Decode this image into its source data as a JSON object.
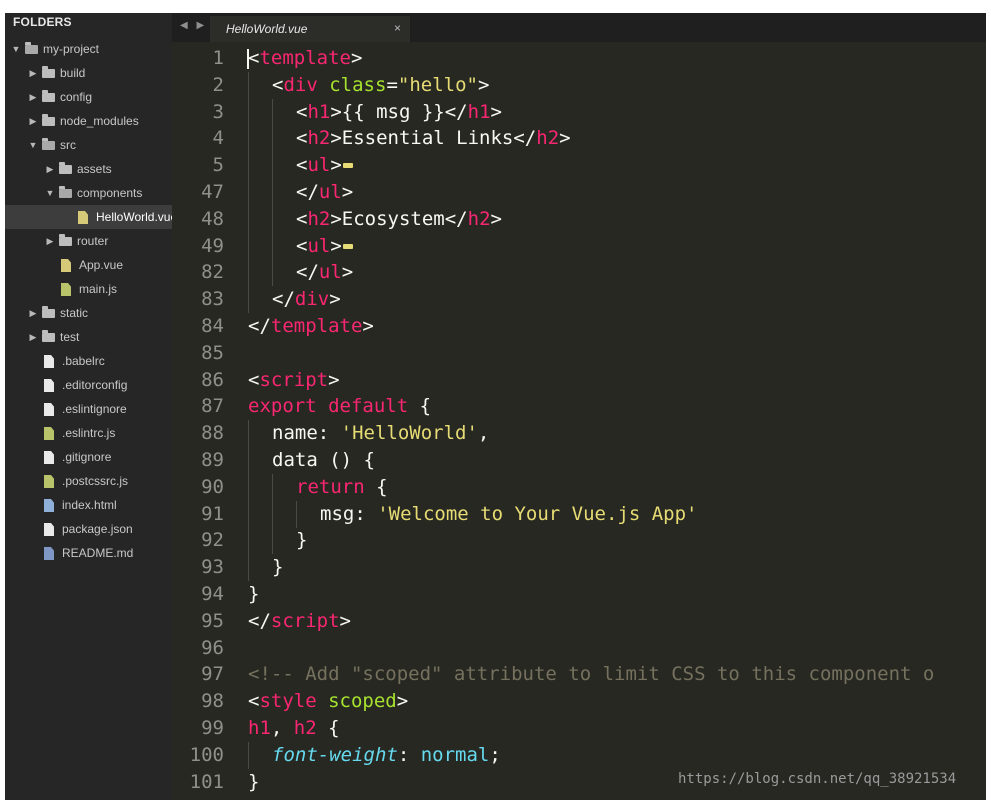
{
  "colors": {
    "tag": "#f92672",
    "attr": "#a6e22e",
    "string": "#e6db74",
    "plain": "#f8f8f2",
    "comment": "#75715e",
    "property": "#66d9ef",
    "fold": "#e6db74"
  },
  "sidebar": {
    "header": "FOLDERS",
    "items": [
      {
        "label": "my-project",
        "kind": "folder",
        "open": true,
        "depth": 0
      },
      {
        "label": "build",
        "kind": "folder",
        "open": false,
        "depth": 1
      },
      {
        "label": "config",
        "kind": "folder",
        "open": false,
        "depth": 1
      },
      {
        "label": "node_modules",
        "kind": "folder",
        "open": false,
        "depth": 1
      },
      {
        "label": "src",
        "kind": "folder",
        "open": true,
        "depth": 1
      },
      {
        "label": "assets",
        "kind": "folder",
        "open": false,
        "depth": 2
      },
      {
        "label": "components",
        "kind": "folder",
        "open": true,
        "depth": 2
      },
      {
        "label": "HelloWorld.vue",
        "kind": "file",
        "type": "vue",
        "depth": 3,
        "selected": true
      },
      {
        "label": "router",
        "kind": "folder",
        "open": false,
        "depth": 2
      },
      {
        "label": "App.vue",
        "kind": "file",
        "type": "vue",
        "depth": 2
      },
      {
        "label": "main.js",
        "kind": "file",
        "type": "js",
        "depth": 2
      },
      {
        "label": "static",
        "kind": "folder",
        "open": false,
        "depth": 1
      },
      {
        "label": "test",
        "kind": "folder",
        "open": false,
        "depth": 1
      },
      {
        "label": ".babelrc",
        "kind": "file",
        "type": "text",
        "depth": 1
      },
      {
        "label": ".editorconfig",
        "kind": "file",
        "type": "text",
        "depth": 1
      },
      {
        "label": ".eslintignore",
        "kind": "file",
        "type": "text",
        "depth": 1
      },
      {
        "label": ".eslintrc.js",
        "kind": "file",
        "type": "js",
        "depth": 1
      },
      {
        "label": ".gitignore",
        "kind": "file",
        "type": "text",
        "depth": 1
      },
      {
        "label": ".postcssrc.js",
        "kind": "file",
        "type": "js",
        "depth": 1
      },
      {
        "label": "index.html",
        "kind": "file",
        "type": "html",
        "depth": 1
      },
      {
        "label": "package.json",
        "kind": "file",
        "type": "text",
        "depth": 1
      },
      {
        "label": "README.md",
        "kind": "file",
        "type": "md",
        "depth": 1
      }
    ]
  },
  "tabbar": {
    "nav_icons": "◀ ▶",
    "active_tab": "HelloWorld.vue",
    "close_glyph": "×"
  },
  "editor": {
    "lines": [
      {
        "n": "1",
        "indent": 0,
        "tokens": [
          [
            "<",
            "plain"
          ],
          [
            "template",
            "tag"
          ],
          [
            ">",
            "plain"
          ]
        ]
      },
      {
        "n": "2",
        "indent": 1,
        "tokens": [
          [
            "<",
            "plain"
          ],
          [
            "div",
            "tag"
          ],
          [
            " ",
            "plain"
          ],
          [
            "class",
            "attr"
          ],
          [
            "=",
            "plain"
          ],
          [
            "\"hello\"",
            "string"
          ],
          [
            ">",
            "plain"
          ]
        ]
      },
      {
        "n": "3",
        "indent": 2,
        "tokens": [
          [
            "<",
            "plain"
          ],
          [
            "h1",
            "tag"
          ],
          [
            ">{{ msg }}</",
            "plain"
          ],
          [
            "h1",
            "tag"
          ],
          [
            ">",
            "plain"
          ]
        ]
      },
      {
        "n": "4",
        "indent": 2,
        "tokens": [
          [
            "<",
            "plain"
          ],
          [
            "h2",
            "tag"
          ],
          [
            ">Essential Links</",
            "plain"
          ],
          [
            "h2",
            "tag"
          ],
          [
            ">",
            "plain"
          ]
        ]
      },
      {
        "n": "5",
        "indent": 2,
        "fold": true,
        "tokens": [
          [
            "<",
            "plain"
          ],
          [
            "ul",
            "tag"
          ],
          [
            ">",
            "plain"
          ]
        ]
      },
      {
        "n": "47",
        "indent": 2,
        "tokens": [
          [
            "</",
            "plain"
          ],
          [
            "ul",
            "tag"
          ],
          [
            ">",
            "plain"
          ]
        ]
      },
      {
        "n": "48",
        "indent": 2,
        "tokens": [
          [
            "<",
            "plain"
          ],
          [
            "h2",
            "tag"
          ],
          [
            ">Ecosystem</",
            "plain"
          ],
          [
            "h2",
            "tag"
          ],
          [
            ">",
            "plain"
          ]
        ]
      },
      {
        "n": "49",
        "indent": 2,
        "fold": true,
        "tokens": [
          [
            "<",
            "plain"
          ],
          [
            "ul",
            "tag"
          ],
          [
            ">",
            "plain"
          ]
        ]
      },
      {
        "n": "82",
        "indent": 2,
        "tokens": [
          [
            "</",
            "plain"
          ],
          [
            "ul",
            "tag"
          ],
          [
            ">",
            "plain"
          ]
        ]
      },
      {
        "n": "83",
        "indent": 1,
        "tokens": [
          [
            "</",
            "plain"
          ],
          [
            "div",
            "tag"
          ],
          [
            ">",
            "plain"
          ]
        ]
      },
      {
        "n": "84",
        "indent": 0,
        "tokens": [
          [
            "</",
            "plain"
          ],
          [
            "template",
            "tag"
          ],
          [
            ">",
            "plain"
          ]
        ]
      },
      {
        "n": "85",
        "indent": 0,
        "tokens": []
      },
      {
        "n": "86",
        "indent": 0,
        "tokens": [
          [
            "<",
            "plain"
          ],
          [
            "script",
            "tag"
          ],
          [
            ">",
            "plain"
          ]
        ]
      },
      {
        "n": "87",
        "indent": 0,
        "tokens": [
          [
            "export",
            "tag"
          ],
          [
            " ",
            "plain"
          ],
          [
            "default",
            "tag"
          ],
          [
            " {",
            "plain"
          ]
        ]
      },
      {
        "n": "88",
        "indent": 1,
        "tokens": [
          [
            "name: ",
            "plain"
          ],
          [
            "'HelloWorld'",
            "string"
          ],
          [
            ",",
            "plain"
          ]
        ]
      },
      {
        "n": "89",
        "indent": 1,
        "tokens": [
          [
            "data () {",
            "plain"
          ]
        ]
      },
      {
        "n": "90",
        "indent": 2,
        "tokens": [
          [
            "return",
            "tag"
          ],
          [
            " {",
            "plain"
          ]
        ]
      },
      {
        "n": "91",
        "indent": 3,
        "tokens": [
          [
            "msg: ",
            "plain"
          ],
          [
            "'Welcome to Your Vue.js App'",
            "string"
          ]
        ]
      },
      {
        "n": "92",
        "indent": 2,
        "tokens": [
          [
            "}",
            "plain"
          ]
        ]
      },
      {
        "n": "93",
        "indent": 1,
        "tokens": [
          [
            "}",
            "plain"
          ]
        ]
      },
      {
        "n": "94",
        "indent": 0,
        "tokens": [
          [
            "}",
            "plain"
          ]
        ]
      },
      {
        "n": "95",
        "indent": 0,
        "tokens": [
          [
            "</",
            "plain"
          ],
          [
            "script",
            "tag"
          ],
          [
            ">",
            "plain"
          ]
        ]
      },
      {
        "n": "96",
        "indent": 0,
        "tokens": []
      },
      {
        "n": "97",
        "indent": 0,
        "tokens": [
          [
            "<!-- Add \"scoped\" attribute to limit CSS to this component o",
            "comment"
          ]
        ]
      },
      {
        "n": "98",
        "indent": 0,
        "tokens": [
          [
            "<",
            "plain"
          ],
          [
            "style",
            "tag"
          ],
          [
            " ",
            "plain"
          ],
          [
            "scoped",
            "attr"
          ],
          [
            ">",
            "plain"
          ]
        ]
      },
      {
        "n": "99",
        "indent": 0,
        "tokens": [
          [
            "h1",
            "tag"
          ],
          [
            ", ",
            "plain"
          ],
          [
            "h2",
            "tag"
          ],
          [
            " {",
            "plain"
          ]
        ]
      },
      {
        "n": "100",
        "indent": 1,
        "tokens": [
          [
            "font-weight",
            "property-italic"
          ],
          [
            ": ",
            "plain"
          ],
          [
            "normal",
            "property"
          ],
          [
            ";",
            "plain"
          ]
        ]
      },
      {
        "n": "101",
        "indent": 0,
        "tokens": [
          [
            "}",
            "plain"
          ]
        ]
      }
    ]
  },
  "watermark": "https://blog.csdn.net/qq_38921534"
}
